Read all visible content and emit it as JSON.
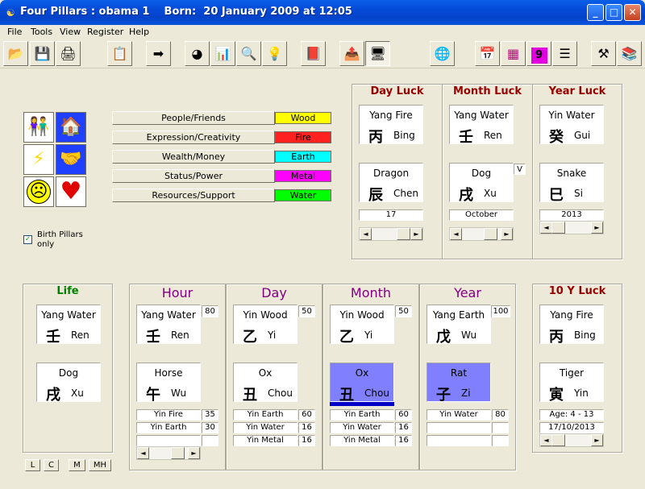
{
  "window": {
    "title": "Four Pillars : obama 1    Born:  20 January 2009 at 12:05",
    "app_icon": "yin-yang-icon"
  },
  "menu": [
    "File",
    "Tools",
    "View",
    "Register",
    "Help"
  ],
  "toolbar": [
    {
      "name": "open-folder-icon",
      "glyph": "📂"
    },
    {
      "name": "save-icon",
      "glyph": "💾"
    },
    {
      "name": "print-icon",
      "glyph": "🖨"
    },
    {
      "name": "properties-icon",
      "glyph": "📋"
    },
    {
      "name": "arrow-right-icon",
      "glyph": "➡"
    },
    {
      "name": "pie-chart-icon",
      "glyph": "◕"
    },
    {
      "name": "bar-chart-icon",
      "glyph": "📊"
    },
    {
      "name": "magnifier-icon",
      "glyph": "🔍"
    },
    {
      "name": "lightbulb-icon",
      "glyph": "💡"
    },
    {
      "name": "book-icon",
      "glyph": "📕"
    },
    {
      "name": "export-icon",
      "glyph": "📤"
    },
    {
      "name": "presentation-icon",
      "glyph": "🖥"
    },
    {
      "name": "globe-icon",
      "glyph": "🌐"
    },
    {
      "name": "calendar-icon",
      "glyph": "📅"
    },
    {
      "name": "grid-icon",
      "glyph": "▦"
    },
    {
      "name": "nine-square-icon",
      "glyph": "9"
    },
    {
      "name": "list-icon",
      "glyph": "☰"
    },
    {
      "name": "tools-icon",
      "glyph": "⚒"
    },
    {
      "name": "books-icon",
      "glyph": "📚"
    }
  ],
  "category_icons": [
    {
      "name": "people-icon",
      "glyph": "👫"
    },
    {
      "name": "house-car-icon",
      "glyph": "🏠"
    },
    {
      "name": "lightning-icon",
      "glyph": "⚡"
    },
    {
      "name": "handshake-icon",
      "glyph": "🤝"
    },
    {
      "name": "sad-face-icon",
      "glyph": "☹"
    },
    {
      "name": "heart-icon",
      "glyph": "♥"
    }
  ],
  "categories": [
    {
      "label": "People/Friends",
      "element": "Wood",
      "color": "#ffff00"
    },
    {
      "label": "Expression/Creativity",
      "element": "Fire",
      "color": "#ff2020"
    },
    {
      "label": "Wealth/Money",
      "element": "Earth",
      "color": "#00ffff"
    },
    {
      "label": "Status/Power",
      "element": "Metal",
      "color": "#ff00ff"
    },
    {
      "label": "Resources/Support",
      "element": "Water",
      "color": "#00ff00"
    }
  ],
  "birth_pillars": {
    "label": "Birth Pillars only",
    "checked": true
  },
  "luck": {
    "day": {
      "title": "Day Luck",
      "stem": {
        "top": "Yang Fire",
        "hz": "丙",
        "py": "Bing"
      },
      "branch": {
        "top": "Dragon",
        "hz": "辰",
        "py": "Chen"
      },
      "value": "17"
    },
    "month": {
      "title": "Month Luck",
      "stem": {
        "top": "Yang Water",
        "hz": "壬",
        "py": "Ren"
      },
      "branch": {
        "top": "Dog",
        "hz": "戌",
        "py": "Xu"
      },
      "value": "October",
      "flag": "V"
    },
    "year": {
      "title": "Year Luck",
      "stem": {
        "top": "Yin Water",
        "hz": "癸",
        "py": "Gui"
      },
      "branch": {
        "top": "Snake",
        "hz": "巳",
        "py": "Si"
      },
      "value": "2013"
    }
  },
  "life": {
    "title": "Life",
    "stem": {
      "top": "Yang Water",
      "hz": "壬",
      "py": "Ren"
    },
    "branch": {
      "top": "Dog",
      "hz": "戌",
      "py": "Xu"
    }
  },
  "pillars": [
    {
      "title": "Hour",
      "stem": {
        "top": "Yang Water",
        "hz": "壬",
        "py": "Ren",
        "score": "80"
      },
      "branch": {
        "top": "Horse",
        "hz": "午",
        "py": "Wu"
      },
      "hidden": [
        {
          "label": "Yin Fire",
          "value": "35"
        },
        {
          "label": "Yin Earth",
          "value": "30"
        },
        {
          "label": "",
          "value": ""
        }
      ]
    },
    {
      "title": "Day",
      "stem": {
        "top": "Yin Wood",
        "hz": "乙",
        "py": "Yi",
        "score": "50"
      },
      "branch": {
        "top": "Ox",
        "hz": "丑",
        "py": "Chou"
      },
      "hidden": [
        {
          "label": "Yin Earth",
          "value": "60"
        },
        {
          "label": "Yin Water",
          "value": "16"
        },
        {
          "label": "Yin Metal",
          "value": "16"
        }
      ]
    },
    {
      "title": "Month",
      "stem": {
        "top": "Yin Wood",
        "hz": "乙",
        "py": "Yi",
        "score": "50"
      },
      "branch": {
        "top": "Ox",
        "hz": "丑",
        "py": "Chou"
      },
      "hidden": [
        {
          "label": "Yin Earth",
          "value": "60"
        },
        {
          "label": "Yin Water",
          "value": "16"
        },
        {
          "label": "Yin Metal",
          "value": "16"
        }
      ]
    },
    {
      "title": "Year",
      "stem": {
        "top": "Yang Earth",
        "hz": "戊",
        "py": "Wu",
        "score": "100"
      },
      "branch": {
        "top": "Rat",
        "hz": "子",
        "py": "Zi"
      },
      "hidden": [
        {
          "label": "Yin Water",
          "value": "80"
        },
        {
          "label": "",
          "value": ""
        },
        {
          "label": "",
          "value": ""
        }
      ]
    }
  ],
  "ten_year": {
    "title": "10 Y Luck",
    "stem": {
      "top": "Yang Fire",
      "hz": "丙",
      "py": "Bing"
    },
    "branch": {
      "top": "Tiger",
      "hz": "寅",
      "py": "Yin"
    },
    "age": "Age: 4 - 13",
    "date": "17/10/2013"
  },
  "bottom_buttons": [
    "L",
    "C",
    "M",
    "MH"
  ],
  "colors": {
    "heading": "#990000",
    "pillar_heading": "#800080",
    "life_heading": "#008000",
    "highlight": "#8080ff"
  }
}
